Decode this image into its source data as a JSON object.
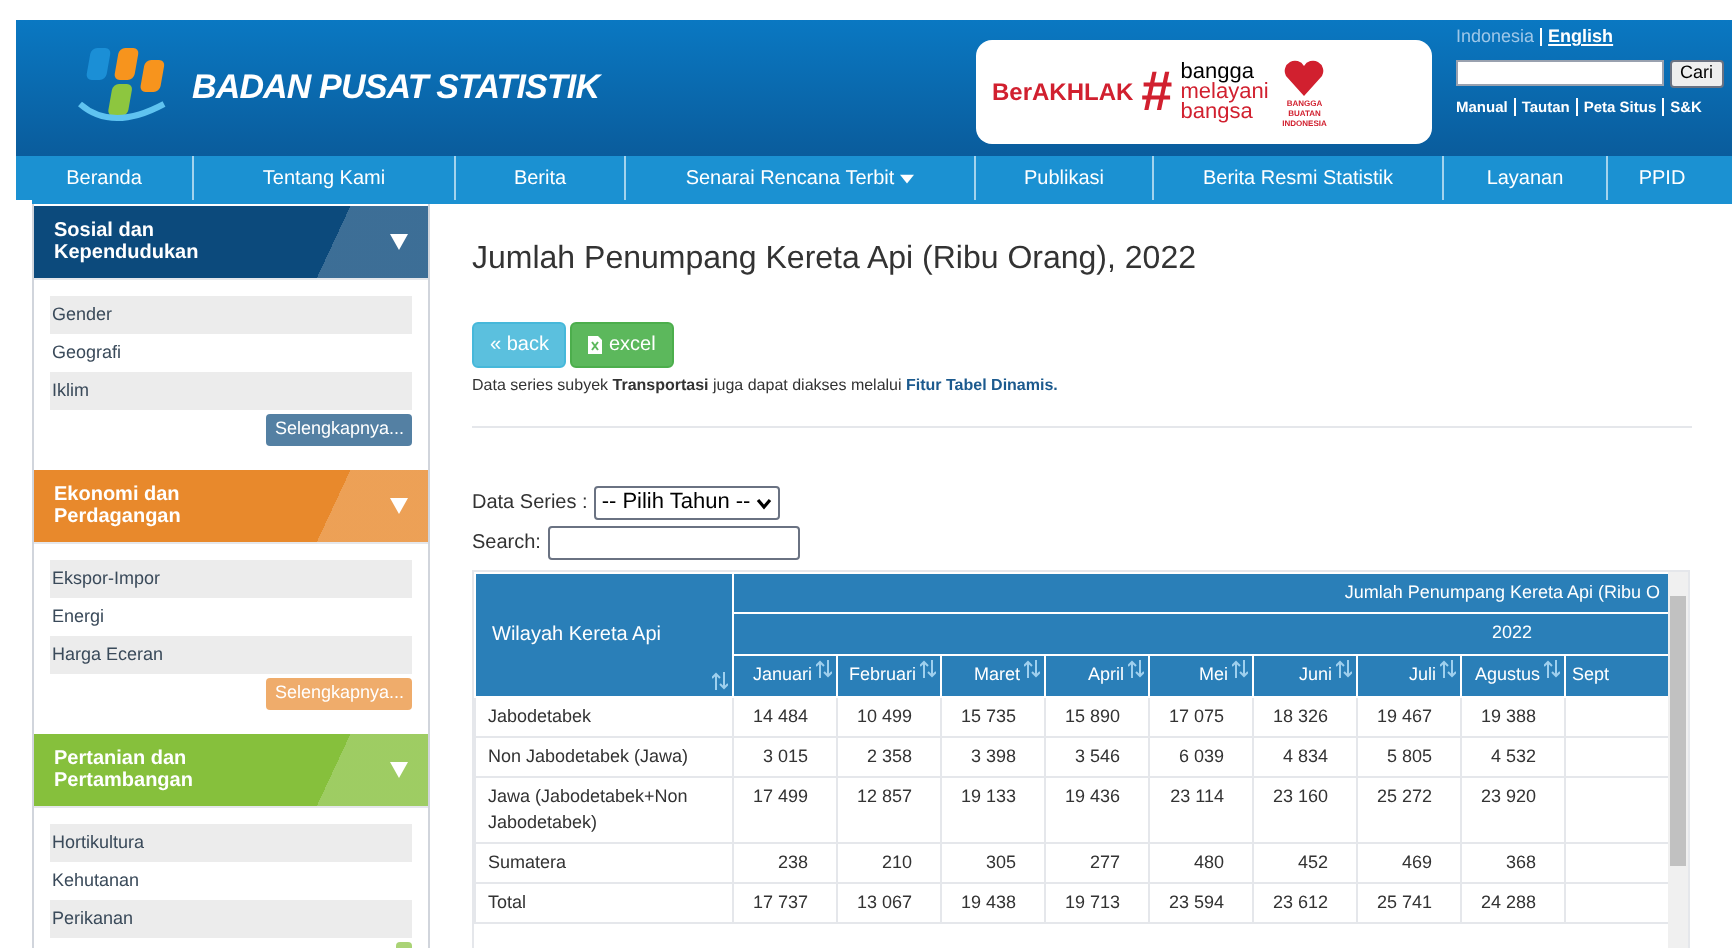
{
  "header": {
    "site_name": "BADAN PUSAT STATISTIK",
    "banner": {
      "brand": "BerAKHLAK",
      "hashtag": "#",
      "slogan": [
        "bangga",
        "melayani",
        "bangsa"
      ],
      "badge": "BANGGA BUATAN INDONESIA"
    },
    "languages": [
      {
        "label": "Indonesia",
        "selected": false
      },
      {
        "label": "English",
        "selected": true
      }
    ],
    "search_button": "Cari",
    "links": [
      "Manual",
      "Tautan",
      "Peta Situs",
      "S&K"
    ]
  },
  "nav": [
    {
      "label": "Beranda"
    },
    {
      "label": "Tentang Kami"
    },
    {
      "label": "Berita"
    },
    {
      "label": "Senarai Rencana Terbit",
      "dropdown": true
    },
    {
      "label": "Publikasi"
    },
    {
      "label": "Berita Resmi Statistik"
    },
    {
      "label": "Layanan"
    },
    {
      "label": "PPID"
    }
  ],
  "sidebar": [
    {
      "title": "Sosial dan Kependudukan",
      "color": "#0c4a7c",
      "items": [
        "Gender",
        "Geografi",
        "Iklim"
      ],
      "more": "Selengkapnya..."
    },
    {
      "title": "Ekonomi dan Perdagangan",
      "color": "#e8892c",
      "items": [
        "Ekspor-Impor",
        "Energi",
        "Harga Eceran"
      ],
      "more": "Selengkapnya..."
    },
    {
      "title": "Pertanian dan Pertambangan",
      "color": "#86c03c",
      "items": [
        "Hortikultura",
        "Kehutanan",
        "Perikanan"
      ]
    }
  ],
  "title": "Jumlah Penumpang Kereta Api (Ribu Orang), 2022",
  "buttons": [
    {
      "kind": "back",
      "label": "« back"
    },
    {
      "kind": "excel",
      "label": "excel"
    }
  ],
  "note": "Data series subyek **Transportasi** juga dapat diakses melalui",
  "note_link": "Fitur Tabel Dinamis.",
  "series_label": "Data Series :",
  "series_select": "-- Pilih Tahun --",
  "search_label": "Search:",
  "table": {
    "row_header": "Wilayah Kereta Api",
    "group_header": "Jumlah Penumpang Kereta Api (Ribu O",
    "year": "2022",
    "columns": [
      "Januari",
      "Februari",
      "Maret",
      "April",
      "Mei",
      "Juni",
      "Juli",
      "Agustus",
      "Sept"
    ],
    "rows": [
      {
        "name": "Jabodetabek",
        "values": [
          "14 484",
          "10 499",
          "15 735",
          "15 890",
          "17 075",
          "18 326",
          "19 467",
          "19 388"
        ]
      },
      {
        "name": "Non Jabodetabek (Jawa)",
        "values": [
          "3 015",
          "2 358",
          "3 398",
          "3 546",
          "6 039",
          "4 834",
          "5 805",
          "4 532"
        ]
      },
      {
        "name": "Jawa (Jabodetabek+Non Jabodetabek)",
        "values": [
          "17 499",
          "12 857",
          "19 133",
          "19 436",
          "23 114",
          "23 160",
          "25 272",
          "23 920"
        ]
      },
      {
        "name": "Sumatera",
        "values": [
          "238",
          "210",
          "305",
          "277",
          "480",
          "452",
          "469",
          "368"
        ]
      },
      {
        "name": "Total",
        "values": [
          "17 737",
          "13 067",
          "19 438",
          "19 713",
          "23 594",
          "23 612",
          "25 741",
          "24 288"
        ]
      }
    ]
  }
}
